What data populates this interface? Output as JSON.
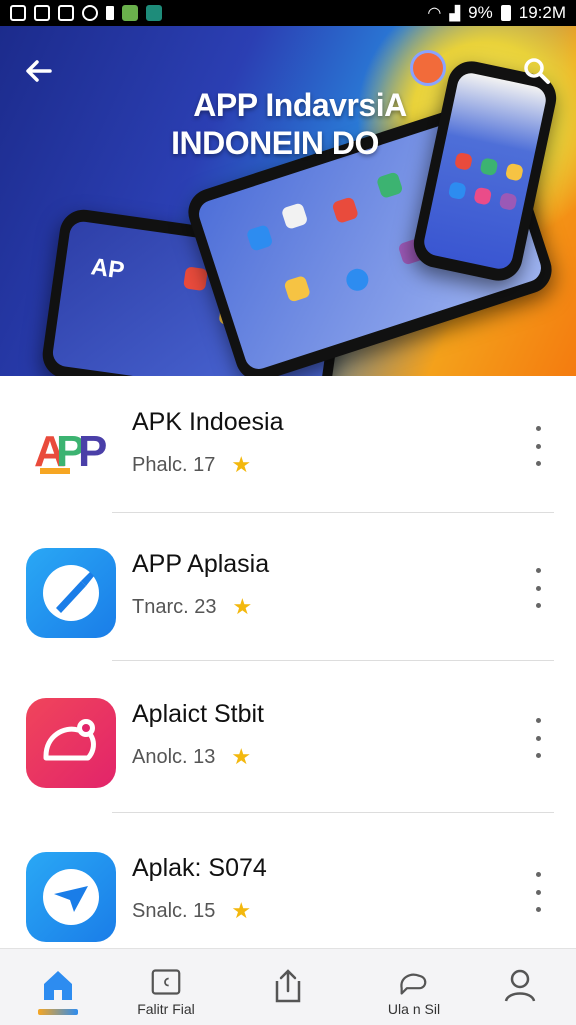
{
  "status_bar": {
    "battery_text": "9%",
    "time": "19:2M"
  },
  "header": {
    "title_line1": "APP IndavrsiA",
    "title_line2": "INDONEIN DO",
    "back_icon": "arrow-left-icon",
    "search_icon": "search-icon"
  },
  "apps": [
    {
      "name": "APK Indoesia",
      "meta": "Phalc. 17",
      "icon": "apk-logo-icon"
    },
    {
      "name": "APP Aplasia",
      "meta": "Tnarc. 23",
      "icon": "brush-app-icon"
    },
    {
      "name": "Aplaict Stbit",
      "meta": "Anolc. 13",
      "icon": "chat-bubble-app-icon"
    },
    {
      "name": "Aplak: S074",
      "meta": "Snalc. 15",
      "icon": "plane-app-icon"
    }
  ],
  "colors": {
    "accent": "#2d8cf0",
    "star": "#f3b80e",
    "app1": "#ffffff",
    "app2": "#1e9bf0",
    "app3": "#e8345a",
    "app4": "#1e9bf0"
  },
  "bottom_nav": [
    {
      "icon": "home-icon",
      "label": "",
      "active": true
    },
    {
      "icon": "calendar-icon",
      "label": "Falitr Fial"
    },
    {
      "icon": "share-icon",
      "label": ""
    },
    {
      "icon": "chat-icon",
      "label": "Ula n Sil"
    },
    {
      "icon": "profile-icon",
      "label": ""
    }
  ]
}
